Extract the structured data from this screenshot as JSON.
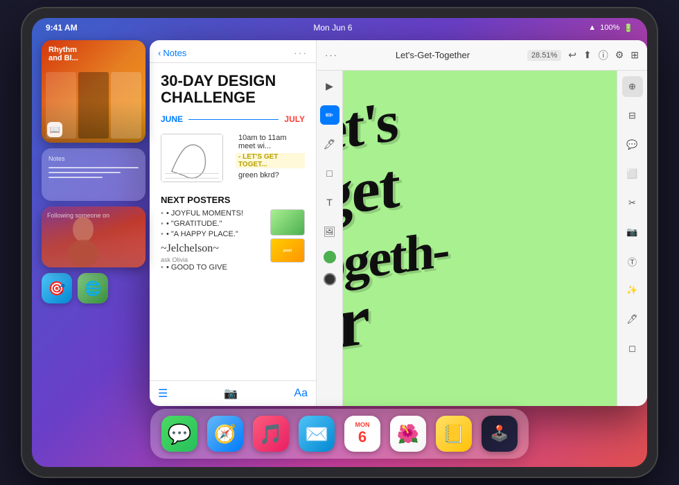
{
  "device": {
    "status_bar": {
      "time": "9:41 AM",
      "date": "Mon Jun 6",
      "battery": "100%",
      "wifi_icon": "wifi",
      "battery_icon": "battery"
    }
  },
  "notes_app": {
    "back_label": "Notes",
    "dots": "···",
    "title": "30-DAY DESIGN CHALLENGE",
    "timeline": {
      "start": "JUNE",
      "end": "JULY"
    },
    "time_note": "10am to 11am meet wi...",
    "highlight_note": "LET'S GET TOGET...",
    "green_note": "green bkrd?",
    "section_title": "NEXT POSTERS",
    "posters": [
      "JOYFUL MOMENTS!",
      "\"GRATITUDE.\"",
      "\"A HAPPY PLACE.\"",
      "GOOD TO GIVE"
    ],
    "note_from": "ask Olivia",
    "footer_icons": [
      "list-icon",
      "camera-icon",
      "aa-icon"
    ]
  },
  "drawing_app": {
    "title": "Let's-Get-Together",
    "zoom": "28.51%",
    "header_icons": [
      "undo",
      "share",
      "info",
      "gear",
      "grid"
    ],
    "left_tools": [
      "cursor",
      "pen",
      "pencil",
      "shape",
      "text",
      "image",
      "circle-green",
      "circle-black"
    ],
    "right_tools": [
      "layers",
      "grid",
      "comment",
      "frames",
      "scissors",
      "camera",
      "typography",
      "effects",
      "pen-tool",
      "eraser"
    ],
    "canvas": {
      "background_color": "#a8f090",
      "artwork_description": "Bold black hand-lettered typography on mint green background"
    }
  },
  "dock": {
    "apps": [
      {
        "name": "Messages",
        "icon": "💬",
        "class": "messages"
      },
      {
        "name": "Safari",
        "icon": "🧭",
        "class": "safari"
      },
      {
        "name": "Music",
        "icon": "🎵",
        "class": "music"
      },
      {
        "name": "Mail",
        "icon": "✉️",
        "class": "mail"
      },
      {
        "name": "Calendar",
        "day": "6",
        "month": "MON",
        "class": "calendar"
      },
      {
        "name": "Photos",
        "icon": "🌺",
        "class": "photos"
      },
      {
        "name": "Notes",
        "icon": "📝",
        "class": "notes"
      },
      {
        "name": "Arcade",
        "icon": "🎮",
        "class": "arcade"
      }
    ]
  },
  "left_widgets": {
    "rhythm_title": "Rhythm\nand Bl...",
    "app_icon_1": "🎯",
    "app_icon_2": "🔵"
  }
}
